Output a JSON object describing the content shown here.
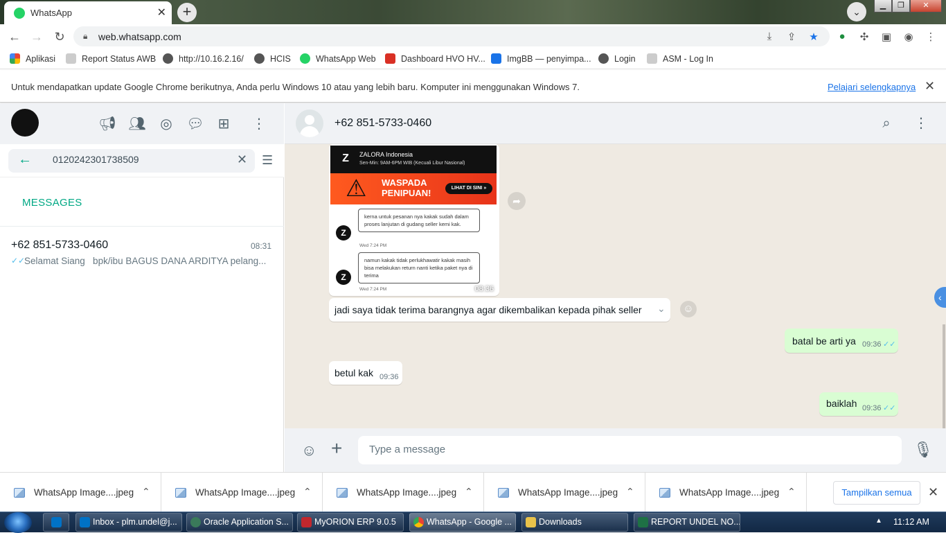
{
  "browser": {
    "tab_title": "WhatsApp",
    "url": "web.whatsapp.com",
    "bookmarks": [
      "Aplikasi",
      "Report Status AWB",
      "http://10.16.2.16/",
      "HCIS",
      "WhatsApp Web",
      "Dashboard HVO HV...",
      "ImgBB — penyimpa...",
      "Login",
      "ASM - Log In"
    ],
    "infobar": {
      "message": "Untuk mendapatkan update Google Chrome berikutnya, Anda perlu Windows 10 atau yang lebih baru. Komputer ini menggunakan Windows 7.",
      "link": "Pelajari selengkapnya"
    }
  },
  "sidebar": {
    "search_value": "0120242301738509",
    "section_label": "MESSAGES",
    "result": {
      "name": "+62 851-5733-0460",
      "time": "08:31",
      "snippet": "Selamat Siang   bpk/ibu BAGUS DANA ARDITYA pelang..."
    }
  },
  "chat": {
    "contact": "+62 851-5733-0460",
    "image_message": {
      "time": "08:36",
      "brand": "ZALORA Indonesia",
      "hours": "Sen-Min: 9AM-6PM WIB (Kecuali Libur Nasional)",
      "banner_line1": "WASPADA",
      "banner_line2": "PENIPUAN!",
      "banner_button": "LIHAT DI SINI »",
      "bubble1": "kerna untuk pesanan nya kakak sudah dalam proses lanjutan di gudang seller kemi kak.",
      "bubble1_time": "Wed 7:24 PM",
      "bubble2": "namun kakak tidak perlukhawatir kakak masih bisa melakukan return nanti ketika paket nya di terima",
      "bubble2_time": "Wed 7:24 PM"
    },
    "messages": [
      {
        "text": "jadi saya tidak terima barangnya agar dikembalikan kepada pihak seller",
        "time": "",
        "direction": "in"
      },
      {
        "text": "batal be arti ya",
        "time": "09:36",
        "direction": "out"
      },
      {
        "text": "betul kak",
        "time": "09:36",
        "direction": "in"
      },
      {
        "text": "baiklah",
        "time": "09:36",
        "direction": "out"
      }
    ],
    "composer_placeholder": "Type a message"
  },
  "downloads": {
    "items": [
      "WhatsApp Image....jpeg",
      "WhatsApp Image....jpeg",
      "WhatsApp Image....jpeg",
      "WhatsApp Image....jpeg",
      "WhatsApp Image....jpeg"
    ],
    "show_all": "Tampilkan semua"
  },
  "taskbar": {
    "items": [
      "Inbox - plm.undel@j...",
      "Oracle Application S...",
      "MyORION ERP 9.0.5",
      "WhatsApp - Google ...",
      "Downloads",
      "REPORT UNDEL NO..."
    ],
    "clock": "11:12 AM"
  },
  "colors": {
    "accent": "#00a884",
    "outgoing_bubble": "#d9fdd3",
    "chat_bg": "#efeae2",
    "read_ticks": "#53bdeb"
  }
}
